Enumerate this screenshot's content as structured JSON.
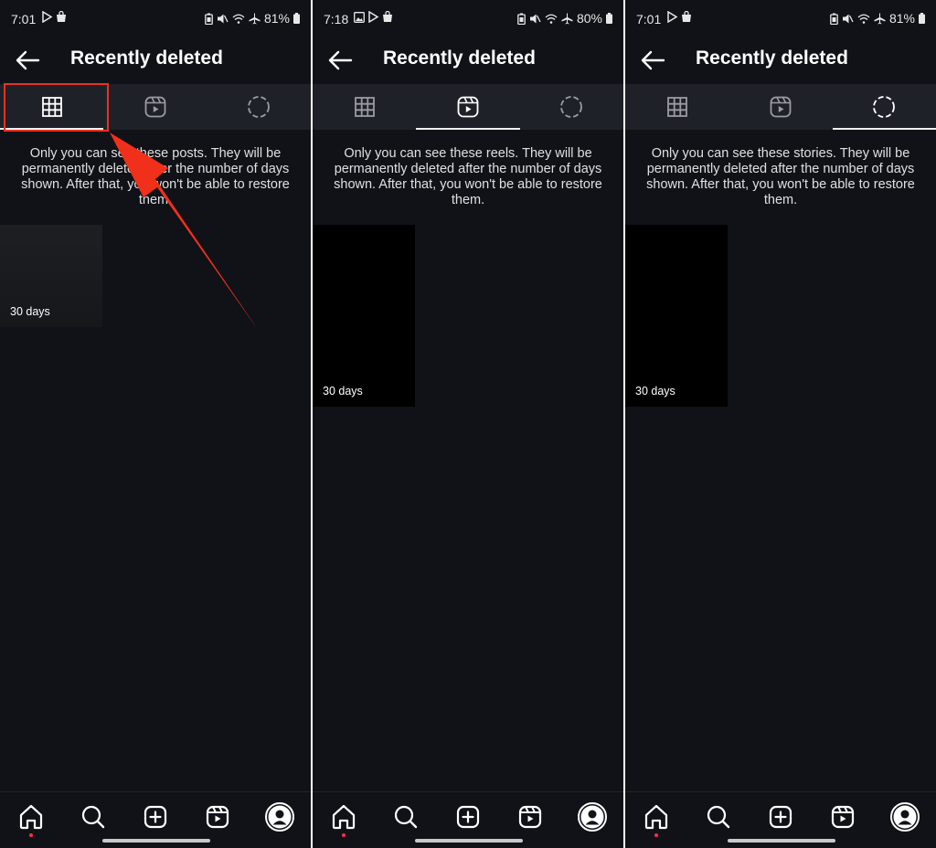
{
  "panels": [
    {
      "status": {
        "time": "7:01",
        "battery": "81%"
      },
      "header": {
        "title": "Recently deleted"
      },
      "active_tab": "posts",
      "notice": "Only you can see these posts. They will be permanently deleted after the number of days shown. After that, you won't be able to restore them.",
      "item": {
        "label": "30 days",
        "kind": "post"
      }
    },
    {
      "status": {
        "time": "7:18",
        "battery": "80%"
      },
      "header": {
        "title": "Recently deleted"
      },
      "active_tab": "reels",
      "notice": "Only you can see these reels. They will be permanently deleted after the number of days shown. After that, you won't be able to restore them.",
      "item": {
        "label": "30 days",
        "kind": "reel"
      }
    },
    {
      "status": {
        "time": "7:01",
        "battery": "81%"
      },
      "header": {
        "title": "Recently deleted"
      },
      "active_tab": "stories",
      "notice": "Only you can see these stories. They will be permanently deleted after the number of days shown. After that, you won't be able to restore them.",
      "item": {
        "label": "30 days",
        "kind": "story"
      }
    }
  ],
  "tabs": [
    {
      "id": "posts",
      "icon": "grid-icon"
    },
    {
      "id": "reels",
      "icon": "reels-icon"
    },
    {
      "id": "stories",
      "icon": "story-ring-icon"
    }
  ],
  "bottom_nav": [
    {
      "id": "home",
      "icon": "home-icon"
    },
    {
      "id": "search",
      "icon": "search-icon"
    },
    {
      "id": "create",
      "icon": "plus-square-icon"
    },
    {
      "id": "reels",
      "icon": "reels-icon"
    },
    {
      "id": "profile",
      "icon": "profile-avatar-icon"
    }
  ],
  "annotation": {
    "color": "#e8321f",
    "target": "posts tab"
  },
  "colors": {
    "background": "#101218",
    "tabbar": "#1f2128",
    "accent_dot": "#ff3040"
  }
}
